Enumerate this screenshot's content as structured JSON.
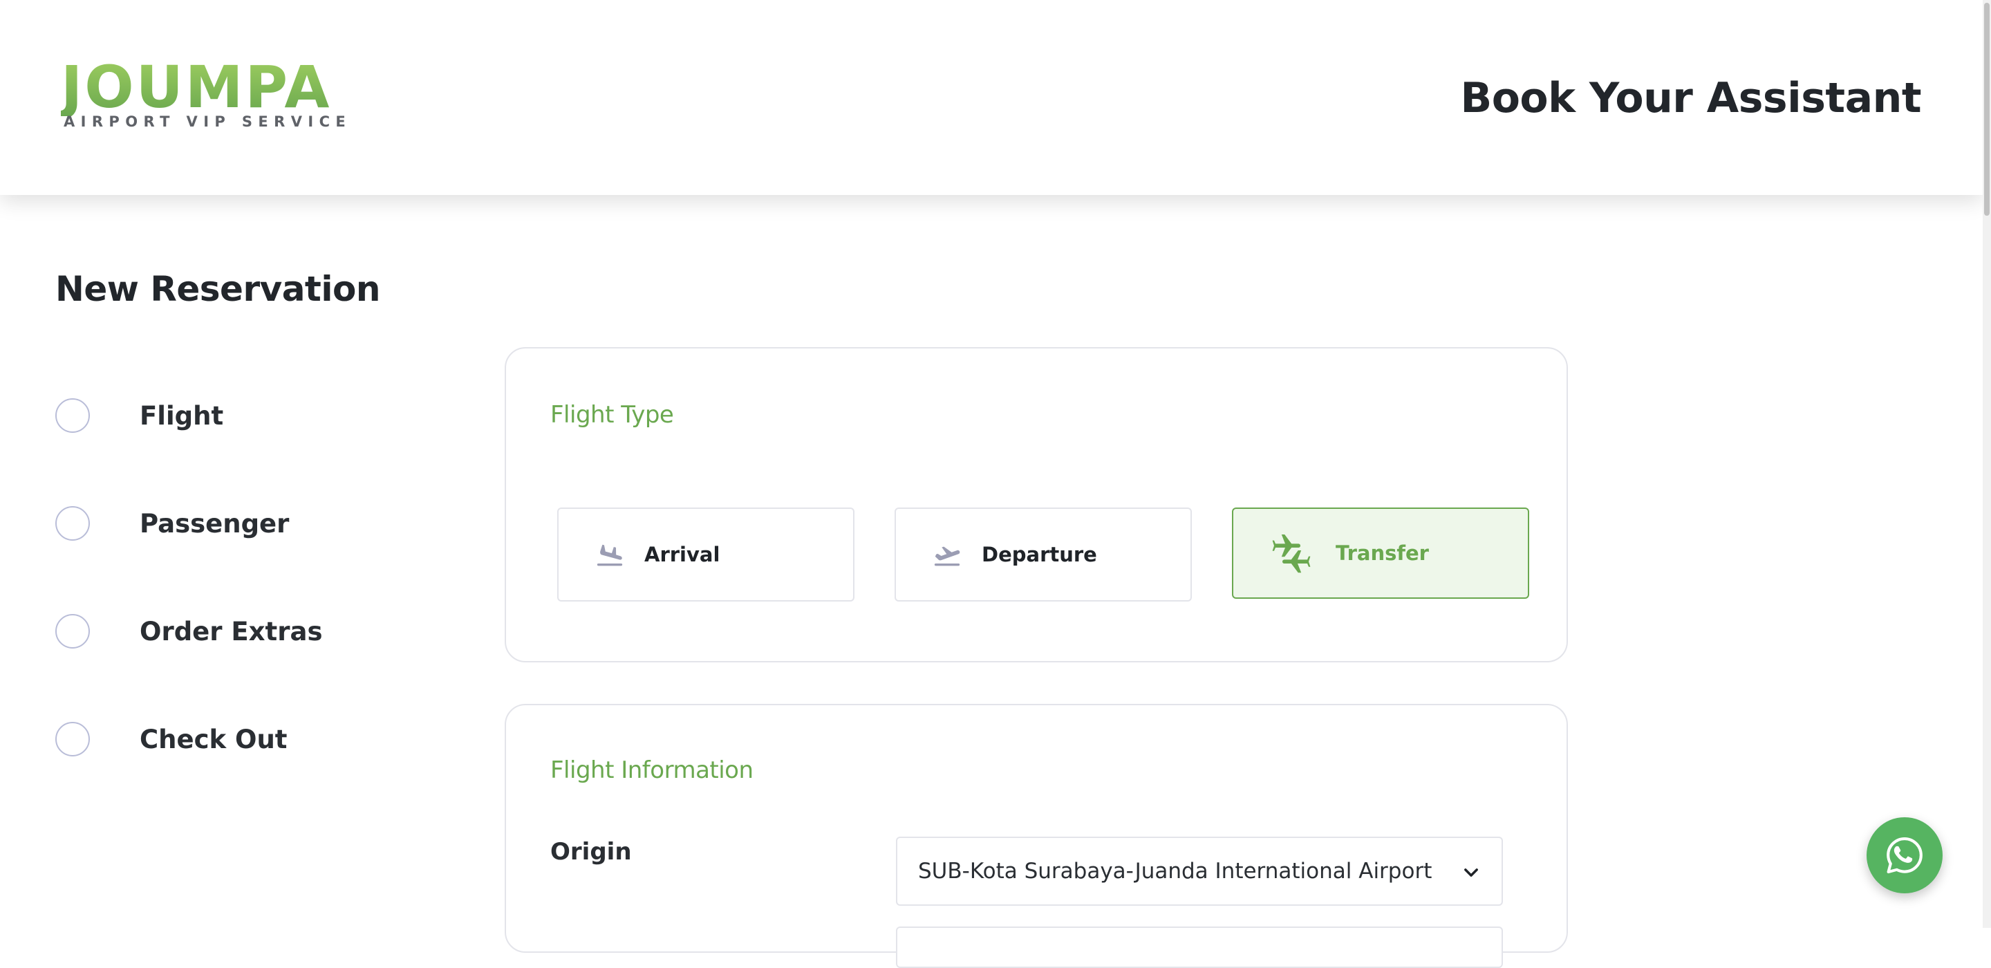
{
  "brand": {
    "logo_text": "JOUMPA",
    "logo_tagline": "AIRPORT VIP SERVICE",
    "primary_color": "#6aa84f",
    "selected_bg": "#eef7ea"
  },
  "header": {
    "title": "Book Your Assistant"
  },
  "page": {
    "title": "New Reservation"
  },
  "steps": [
    {
      "label": "Flight",
      "completed": false
    },
    {
      "label": "Passenger",
      "completed": false
    },
    {
      "label": "Order Extras",
      "completed": false
    },
    {
      "label": "Check Out",
      "completed": false
    }
  ],
  "flight_type": {
    "heading": "Flight Type",
    "options": [
      {
        "label": "Arrival",
        "icon": "plane-landing-icon",
        "selected": false
      },
      {
        "label": "Departure",
        "icon": "plane-takeoff-icon",
        "selected": false
      },
      {
        "label": "Transfer",
        "icon": "plane-transfer-icon",
        "selected": true
      }
    ]
  },
  "flight_info": {
    "heading": "Flight Information",
    "origin": {
      "label": "Origin",
      "value": "SUB-Kota Surabaya-Juanda International Airport"
    }
  },
  "whatsapp": {
    "icon": "whatsapp-icon",
    "color": "#56b461"
  }
}
